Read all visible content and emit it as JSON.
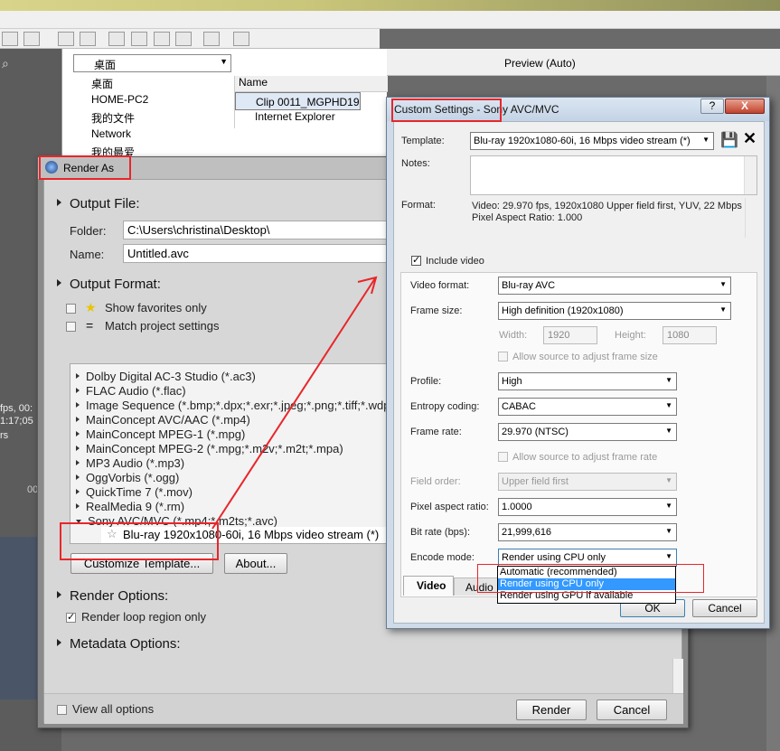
{
  "app": {
    "explorer": {
      "location": "桌面",
      "tree": [
        "桌面",
        "HOME-PC2",
        "我的文件",
        "Network",
        "我的最爱"
      ],
      "files_header": "Name",
      "files": [
        "Clip 0011_MGPHD19",
        "HOME-PC2",
        "Internet Explorer"
      ]
    },
    "preview_label": "Preview (Auto)",
    "left_panel": {
      "text1": "fps, 00:",
      "text2": "1:17;05",
      "text3": "rs",
      "text4": "00"
    }
  },
  "render_as": {
    "title": "Render As",
    "output_file": {
      "heading": "Output File:",
      "folder_label": "Folder:",
      "folder_value": "C:\\Users\\christina\\Desktop\\",
      "name_label": "Name:",
      "name_value": "Untitled.avc"
    },
    "output_format": {
      "heading": "Output Format:",
      "show_favorites": "Show favorites only",
      "match_project": "Match project settings",
      "formats": [
        "Dolby Digital AC-3 Studio (*.ac3)",
        "FLAC Audio (*.flac)",
        "Image Sequence (*.bmp;*.dpx;*.exr;*.jpeg;*.png;*.tiff;*.wdp)",
        "MainConcept AVC/AAC (*.mp4)",
        "MainConcept MPEG-1 (*.mpg)",
        "MainConcept MPEG-2 (*.mpg;*.m2v;*.m2t;*.mpa)",
        "MP3 Audio (*.mp3)",
        "OggVorbis (*.ogg)",
        "QuickTime 7 (*.mov)",
        "RealMedia 9 (*.rm)",
        "Sony AVC/MVC (*.mp4;*.m2ts;*.avc)"
      ],
      "selected_template": "Blu-ray 1920x1080-60i, 16 Mbps video stream (*)"
    },
    "buttons": {
      "customize": "Customize Template...",
      "about": "About...",
      "render": "Render",
      "cancel": "Cancel"
    },
    "render_options": {
      "heading": "Render Options:",
      "loop_region": "Render loop region only"
    },
    "metadata_heading": "Metadata Options:",
    "view_all": "View all options"
  },
  "custom_settings": {
    "title": "Custom Settings - Sony AVC/MVC",
    "help_btn": "?",
    "close_btn": "X",
    "template_label": "Template:",
    "template_value": "Blu-ray 1920x1080-60i, 16 Mbps video stream (*)",
    "notes_label": "Notes:",
    "format_label": "Format:",
    "format_line1": "Video: 29.970 fps, 1920x1080 Upper field first, YUV, 22 Mbps",
    "format_line2": "Pixel Aspect Ratio: 1.000",
    "include_video": "Include video",
    "fields": {
      "video_format": {
        "label": "Video format:",
        "value": "Blu-ray AVC"
      },
      "frame_size": {
        "label": "Frame size:",
        "value": "High definition (1920x1080)"
      },
      "width": {
        "label": "Width:",
        "value": "1920"
      },
      "height": {
        "label": "Height:",
        "value": "1080"
      },
      "allow_frame_size": "Allow source to adjust frame size",
      "profile": {
        "label": "Profile:",
        "value": "High"
      },
      "entropy": {
        "label": "Entropy coding:",
        "value": "CABAC"
      },
      "frame_rate": {
        "label": "Frame rate:",
        "value": "29.970 (NTSC)"
      },
      "allow_frame_rate": "Allow source to adjust frame rate",
      "field_order": {
        "label": "Field order:",
        "value": "Upper field first"
      },
      "par": {
        "label": "Pixel aspect ratio:",
        "value": "1.0000"
      },
      "bitrate": {
        "label": "Bit rate (bps):",
        "value": "21,999,616"
      },
      "encode_mode": {
        "label": "Encode mode:",
        "value": "Render using CPU only"
      }
    },
    "encode_options": [
      "Automatic (recommended)",
      "Render using CPU only",
      "Render using GPU if available"
    ],
    "tabs": [
      "Video",
      "Audio"
    ],
    "ok": "OK",
    "cancel": "Cancel"
  },
  "colors": {
    "annotation": "#e8262a",
    "highlight": "#3399ff"
  }
}
